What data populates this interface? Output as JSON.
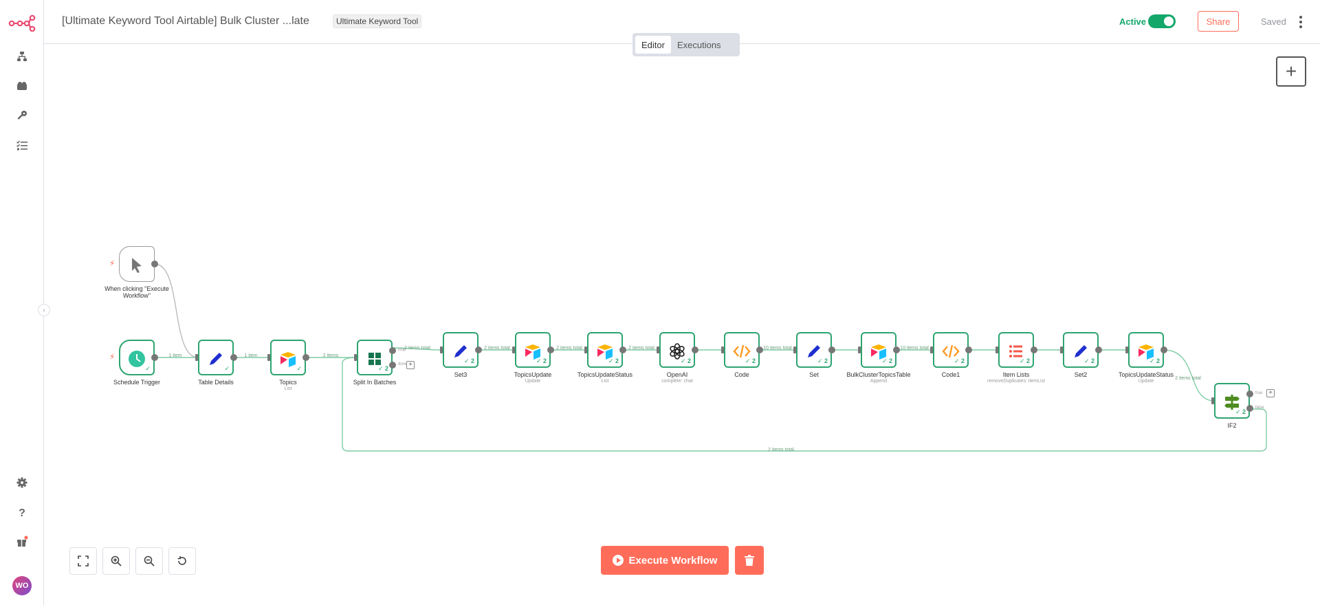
{
  "header": {
    "workflow_title": "[Ultimate Keyword Tool Airtable] Bulk Cluster ...late",
    "tag": "Ultimate Keyword Tool",
    "active_label": "Active",
    "share_label": "Share",
    "saved_label": "Saved"
  },
  "tabs": [
    {
      "label": "Editor",
      "active": true
    },
    {
      "label": "Executions",
      "active": false
    }
  ],
  "sidebar": {
    "items": [
      {
        "icon": "workflows-icon"
      },
      {
        "icon": "templates-icon"
      },
      {
        "icon": "credentials-icon"
      },
      {
        "icon": "executions-icon"
      }
    ],
    "bottom": [
      {
        "icon": "settings-icon"
      },
      {
        "icon": "help-icon"
      },
      {
        "icon": "gift-icon"
      }
    ],
    "avatar": "WO"
  },
  "nodes": [
    {
      "name": "When clicking \"Execute Workflow\"",
      "sub": "",
      "icon": "cursor-icon"
    },
    {
      "name": "Schedule Trigger",
      "sub": "",
      "icon": "clock-icon"
    },
    {
      "name": "Table Details",
      "sub": "",
      "icon": "pencil-icon"
    },
    {
      "name": "Topics",
      "sub": "List",
      "icon": "airtable-icon"
    },
    {
      "name": "Split In Batches",
      "sub": "",
      "icon": "grid-icon",
      "outputs": [
        "loop",
        "done"
      ]
    },
    {
      "name": "Set3",
      "sub": "",
      "icon": "pencil-icon"
    },
    {
      "name": "TopicsUpdate",
      "sub": "Update",
      "icon": "airtable-icon"
    },
    {
      "name": "TopicsUpdateStatus",
      "sub": "List",
      "icon": "airtable-icon"
    },
    {
      "name": "OpenAI",
      "sub": "complete: chat",
      "icon": "openai-icon"
    },
    {
      "name": "Code",
      "sub": "",
      "icon": "code-icon"
    },
    {
      "name": "Set",
      "sub": "",
      "icon": "pencil-icon"
    },
    {
      "name": "BulkClusterTopicsTable",
      "sub": "Append",
      "icon": "airtable-icon"
    },
    {
      "name": "Code1",
      "sub": "",
      "icon": "code-icon"
    },
    {
      "name": "Item Lists",
      "sub": "removeDuplicates: itemList",
      "icon": "list-icon"
    },
    {
      "name": "Set2",
      "sub": "",
      "icon": "pencil-icon"
    },
    {
      "name": "TopicsUpdateStatus",
      "sub": "Update",
      "icon": "airtable-icon"
    },
    {
      "name": "IF2",
      "sub": "",
      "icon": "if-icon",
      "outputs": [
        "true",
        "false"
      ]
    }
  ],
  "edge_labels": [
    "1 item",
    "1 item",
    "2 items",
    "2 items total",
    "2 items total",
    "2 items total",
    "2 items total",
    "10 items total",
    "10 items total",
    "2 items total",
    "2 items total"
  ],
  "node_badge": "2",
  "controls": {
    "execute_label": "Execute Workflow"
  },
  "colors": {
    "accent": "#ff6d5a",
    "success": "#13a76a",
    "edge": "#7fcca3"
  }
}
